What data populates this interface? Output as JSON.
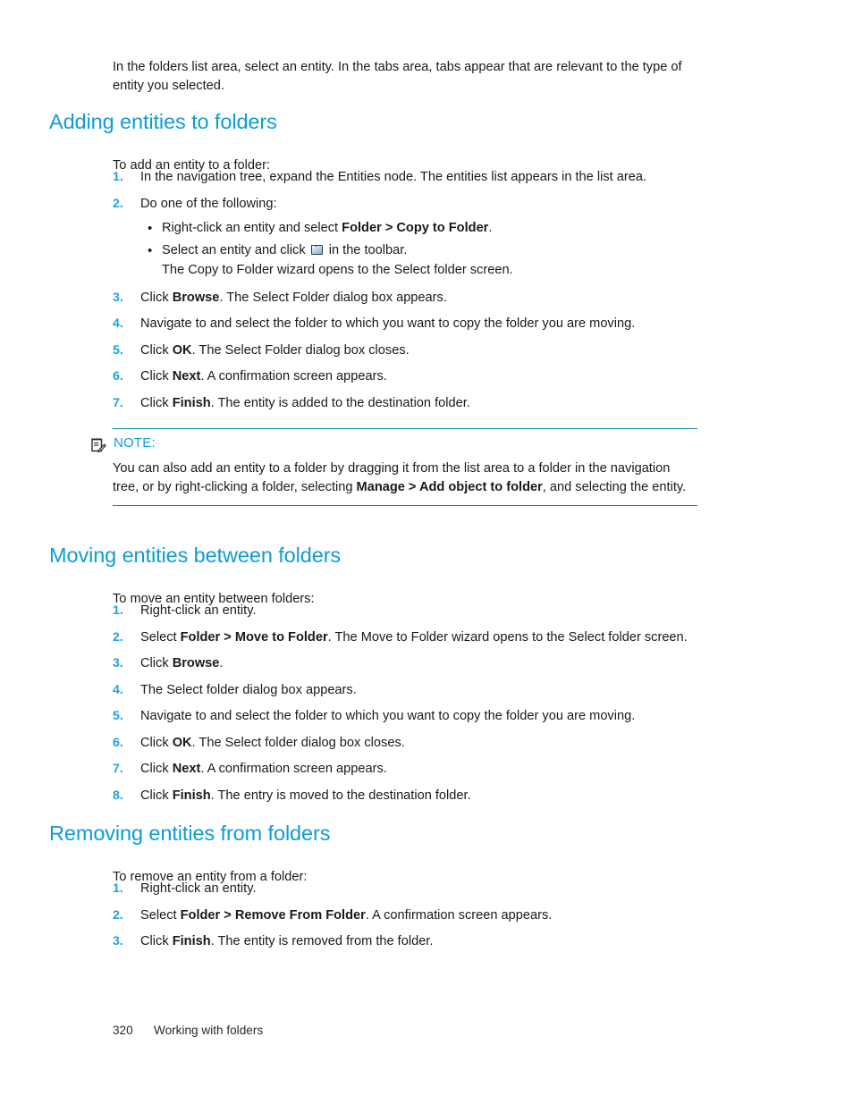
{
  "document": {
    "intro_paragraph": "In the folders list area, select an entity. In the tabs area, tabs appear that are relevant to the type of entity you selected.",
    "footer": {
      "page_number": "320",
      "running_head": "Working with folders"
    },
    "colors": {
      "heading_blue": "#0f9bd7",
      "number_blue": "#1ba3dd",
      "rule_blue": "#0d84b8",
      "body_text": "#1a1a1a"
    }
  },
  "sections": [
    {
      "heading": "Adding entities to folders",
      "lead_in": "To add an entity to a folder:",
      "steps": [
        {
          "number": "1.",
          "text_before": "In the navigation tree, expand the Entities node. The entities list appears in the list area.",
          "bold": "",
          "text_after": ""
        },
        {
          "number": "2.",
          "text_before": "Do one of the following:",
          "bold": "",
          "text_after": "",
          "bullets": [
            {
              "marker": "•",
              "text_before": "Right-click an entity and select ",
              "bold": "Folder > Copy to Folder",
              "text_after": "."
            },
            {
              "marker": "•",
              "text_before": "Select an entity and click ",
              "icon": "folder-icon",
              "text_after": " in the toolbar.",
              "continuation": "The Copy to Folder wizard opens to the Select folder screen."
            }
          ]
        },
        {
          "number": "3.",
          "text_before": "Click ",
          "bold": "Browse",
          "text_after": ". The Select Folder dialog box appears."
        },
        {
          "number": "4.",
          "text_before": "Navigate to and select the folder to which you want to copy the folder you are moving.",
          "bold": "",
          "text_after": ""
        },
        {
          "number": "5.",
          "text_before": "Click ",
          "bold": "OK",
          "text_after": ". The Select Folder dialog box closes."
        },
        {
          "number": "6.",
          "text_before": "Click ",
          "bold": "Next",
          "text_after": ". A confirmation screen appears."
        },
        {
          "number": "7.",
          "text_before": "Click ",
          "bold": "Finish",
          "text_after": ". The entity is added to the destination folder."
        }
      ]
    },
    {
      "heading": "Moving entities between folders",
      "lead_in": "To move an entity between folders:",
      "steps": [
        {
          "number": "1.",
          "text_before": "Right-click an entity.",
          "bold": "",
          "text_after": ""
        },
        {
          "number": "2.",
          "text_before": "Select ",
          "bold": "Folder > Move to Folder",
          "text_after": ". The Move to Folder wizard opens to the Select folder screen."
        },
        {
          "number": "3.",
          "text_before": "Click ",
          "bold": "Browse",
          "text_after": "."
        },
        {
          "number": "4.",
          "text_before": "The Select folder dialog box appears.",
          "bold": "",
          "text_after": ""
        },
        {
          "number": "5.",
          "text_before": "Navigate to and select the folder to which you want to copy the folder you are moving.",
          "bold": "",
          "text_after": ""
        },
        {
          "number": "6.",
          "text_before": "Click ",
          "bold": "OK",
          "text_after": ". The Select folder dialog box closes."
        },
        {
          "number": "7.",
          "text_before": "Click ",
          "bold": "Next",
          "text_after": ". A confirmation screen appears."
        },
        {
          "number": "8.",
          "text_before": "Click ",
          "bold": "Finish",
          "text_after": ". The entry is moved to the destination folder."
        }
      ]
    },
    {
      "heading": "Removing entities from folders",
      "lead_in": "To remove an entity from a folder:",
      "steps": [
        {
          "number": "1.",
          "text_before": "Right-click an entity.",
          "bold": "",
          "text_after": ""
        },
        {
          "number": "2.",
          "text_before": "Select ",
          "bold": "Folder > Remove From Folder",
          "text_after": ". A confirmation screen appears."
        },
        {
          "number": "3.",
          "text_before": "Click ",
          "bold": "Finish",
          "text_after": ". The entity is removed from the folder."
        }
      ]
    }
  ],
  "note": {
    "icon": "note-pad-icon",
    "label": "NOTE:",
    "text_before": "You can also add an entity to a folder by dragging it from the list area to a folder in the navigation tree, or by right-clicking a folder, selecting ",
    "bold": "Manage > Add object to folder",
    "text_after": ", and selecting the entity."
  }
}
